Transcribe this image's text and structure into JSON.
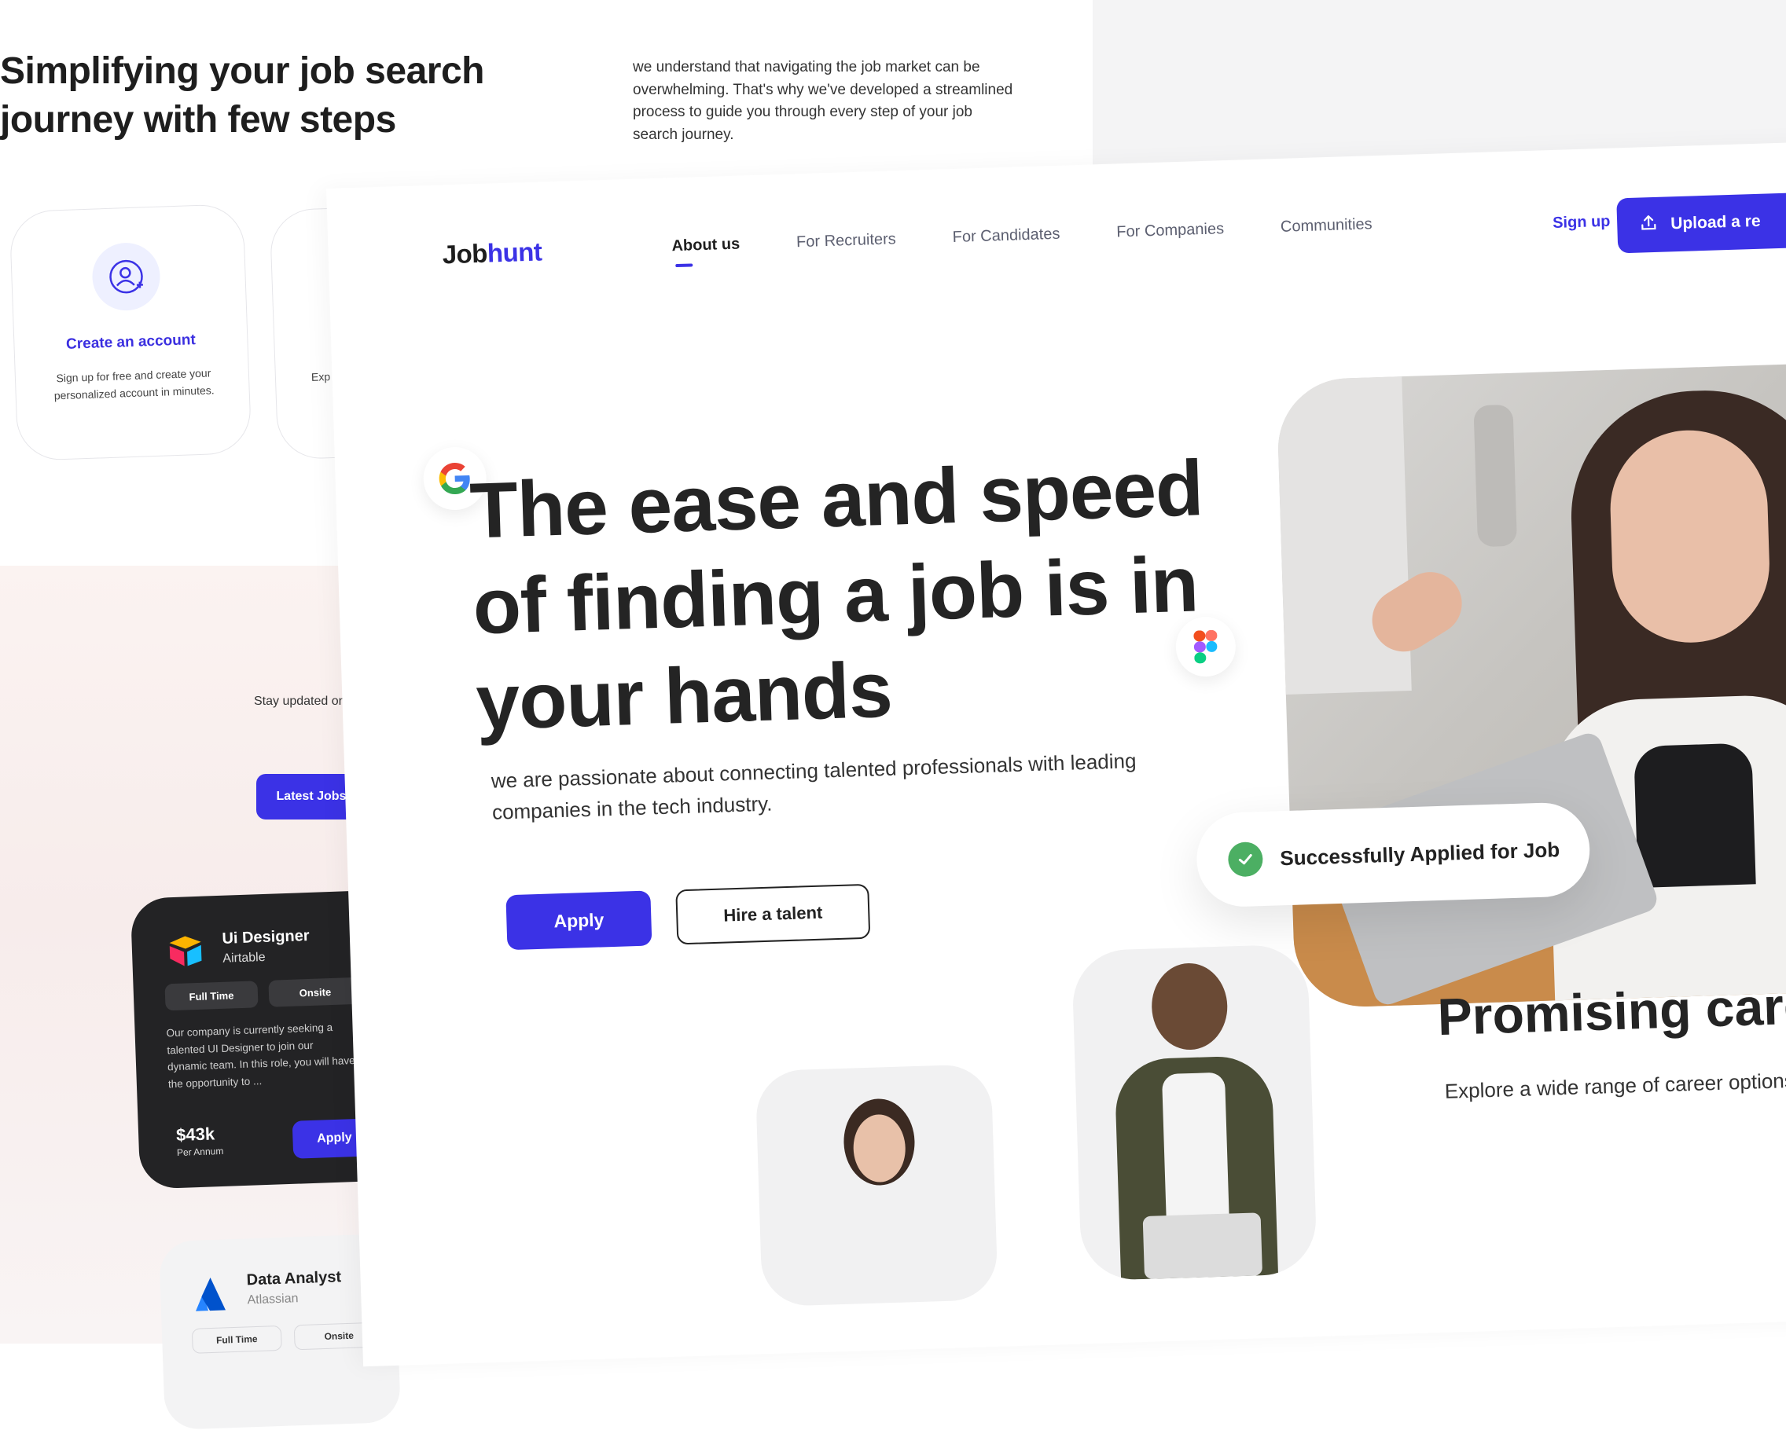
{
  "background_page": {
    "section_title_line1": "Simplifying your job search",
    "section_title_line2": "journey with few steps",
    "description": "we understand that navigating the job market can be overwhelming. That's why we've developed a streamlined process to guide you through every step of your job search journey.",
    "steps": [
      {
        "title": "Create an account",
        "text": "Sign up for free and create your personalized account in minutes.",
        "icon": "user-plus-icon"
      },
      {
        "text_partial": "Exp fro"
      }
    ],
    "stay_updated": "Stay updated on",
    "latest_jobs_button": "Latest Jobs",
    "job_cards": [
      {
        "title": "Ui Designer",
        "company": "Airtable",
        "tags": [
          "Full Time",
          "Onsite"
        ],
        "description": "Our company is currently seeking a talented UI Designer to join our dynamic team. In this role, you will have the opportunity to ...",
        "salary": "$43k",
        "salary_period": "Per Annum",
        "apply_label": "Apply",
        "logo": "airtable-logo-icon"
      },
      {
        "title": "Data Analyst",
        "company": "Atlassian",
        "tags": [
          "Full Time",
          "Onsite"
        ],
        "logo": "atlassian-logo-icon"
      }
    ]
  },
  "header": {
    "brand_part1": "Job",
    "brand_part2": "hunt",
    "nav": [
      "About us",
      "For Recruiters",
      "For Candidates",
      "For Companies",
      "Communities"
    ],
    "active_nav": "About us",
    "signup": "Sign up",
    "upload_button": "Upload a re",
    "upload_icon": "upload-icon"
  },
  "hero": {
    "title_line1": "The ease and speed",
    "title_line2": "of finding a job is in",
    "title_line3": "your hands",
    "subtitle_line1": "we are passionate about connecting talented professionals with leading",
    "subtitle_line2": "companies in the tech industry.",
    "apply_button": "Apply",
    "hire_button": "Hire a talent",
    "toast_text": "Successfully Applied for Job"
  },
  "career": {
    "title": "Promising career opti",
    "text": "Explore a wide range of career options in the technolo"
  },
  "colors": {
    "accent": "#3b32e6",
    "success": "#4caf63",
    "dark_card": "#232325"
  }
}
